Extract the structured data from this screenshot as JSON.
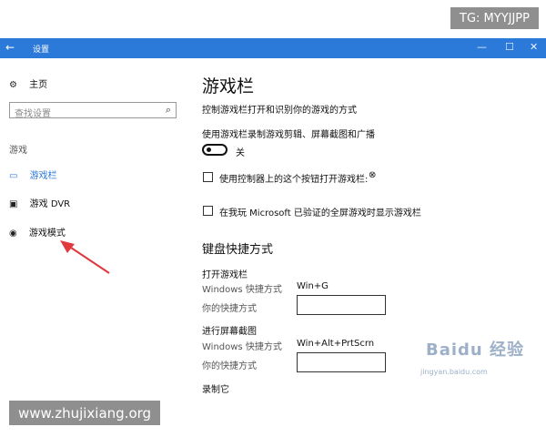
{
  "overlays": {
    "tg": "TG: MYYJJPP",
    "site": "www.zhujixiang.org"
  },
  "titlebar": {
    "back": "←",
    "title": "设置",
    "min": "—",
    "max": "☐",
    "close": "✕"
  },
  "sidebar": {
    "home": "主页",
    "search_placeholder": "查找设置",
    "section": "游戏",
    "items": [
      {
        "label": "游戏栏"
      },
      {
        "label": "游戏 DVR"
      },
      {
        "label": "游戏模式"
      }
    ]
  },
  "main": {
    "title": "游戏栏",
    "subtitle": "控制游戏栏打开和识别你的游戏的方式",
    "record_label": "使用游戏栏录制游戏剪辑、屏幕截图和广播",
    "toggle_state": "关",
    "checkbox1": "使用控制器上的这个按钮打开游戏栏:",
    "checkbox2": "在我玩 Microsoft 已验证的全屏游戏时显示游戏栏",
    "shortcuts_title": "键盘快捷方式",
    "open_group": "打开游戏栏",
    "windows_shortcut_label": "Windows 快捷方式",
    "open_shortcut": "Win+G",
    "your_shortcut_label": "你的快捷方式",
    "screenshot_group": "进行屏幕截图",
    "screenshot_shortcut": "Win+Alt+PrtScrn",
    "record_group": "录制它"
  },
  "watermark": {
    "brand": "Baidu 经验",
    "url": "jingyan.baidu.com"
  },
  "colors": {
    "titlebar": "#2b79d8",
    "accent": "#2b79d8",
    "arrow": "#e0393e"
  }
}
